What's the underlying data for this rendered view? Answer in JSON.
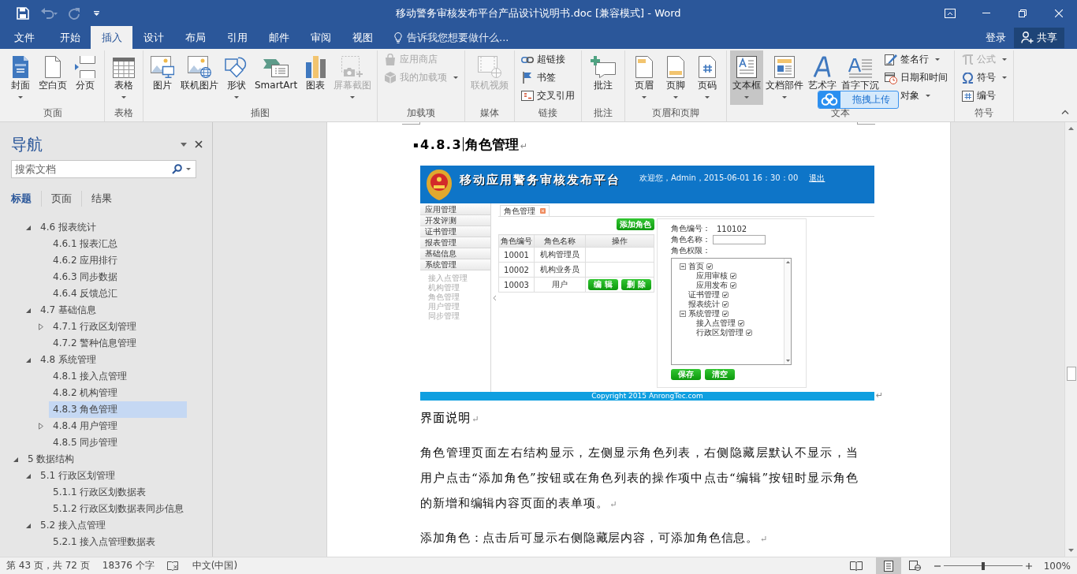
{
  "window": {
    "title": "移动警务审核发布平台产品设计说明书.doc [兼容模式] - Word"
  },
  "quick_access": [
    {
      "kind": "save",
      "disabled": false
    },
    {
      "kind": "undo",
      "disabled": true
    },
    {
      "kind": "redo",
      "disabled": true
    },
    {
      "kind": "customize",
      "disabled": false
    }
  ],
  "tabs": [
    {
      "label": "文件",
      "selected": false
    },
    {
      "label": "开始",
      "selected": false
    },
    {
      "label": "插入",
      "selected": true
    },
    {
      "label": "设计",
      "selected": false
    },
    {
      "label": "布局",
      "selected": false
    },
    {
      "label": "引用",
      "selected": false
    },
    {
      "label": "邮件",
      "selected": false
    },
    {
      "label": "审阅",
      "selected": false
    },
    {
      "label": "视图",
      "selected": false
    }
  ],
  "tell_me": {
    "placeholder": "告诉我您想要做什么..."
  },
  "account": {
    "sign_in": "登录",
    "share": "共享"
  },
  "ribbon": [
    {
      "label": "页面",
      "large": [
        {
          "label": "封面",
          "kind": "cover",
          "dropdown": true,
          "disabled": false,
          "pressed": false
        },
        {
          "label": "空白页",
          "kind": "blank",
          "dropdown": false,
          "disabled": false,
          "pressed": false
        },
        {
          "label": "分页",
          "kind": "break",
          "dropdown": false,
          "disabled": false,
          "pressed": false
        }
      ]
    },
    {
      "label": "表格",
      "large": [
        {
          "label": "表格",
          "kind": "table",
          "dropdown": true,
          "disabled": false,
          "pressed": false
        }
      ]
    },
    {
      "label": "插图",
      "large": [
        {
          "label": "图片",
          "kind": "picture",
          "dropdown": false,
          "disabled": false,
          "pressed": false
        },
        {
          "label": "联机图片",
          "kind": "online",
          "dropdown": false,
          "disabled": false,
          "pressed": false
        },
        {
          "label": "形状",
          "kind": "shapes",
          "dropdown": true,
          "disabled": false,
          "pressed": false
        },
        {
          "label": "SmartArt",
          "kind": "smartart",
          "dropdown": false,
          "disabled": false,
          "pressed": false
        },
        {
          "label": "图表",
          "kind": "chart",
          "dropdown": false,
          "disabled": false,
          "pressed": false
        },
        {
          "label": "屏幕截图",
          "kind": "screenshot",
          "dropdown": true,
          "disabled": true,
          "pressed": false
        }
      ]
    },
    {
      "label": "加载项",
      "small": [
        {
          "label": "应用商店",
          "kind": "store",
          "dropdown": false,
          "disabled": true
        },
        {
          "label": "我的加载项",
          "kind": "addins",
          "dropdown": true,
          "disabled": true
        }
      ]
    },
    {
      "label": "媒体",
      "large": [
        {
          "label": "联机视频",
          "kind": "video",
          "dropdown": false,
          "disabled": true,
          "pressed": false
        }
      ]
    },
    {
      "label": "链接",
      "small": [
        {
          "label": "超链接",
          "kind": "link",
          "dropdown": false,
          "disabled": false
        },
        {
          "label": "书签",
          "kind": "bookmark",
          "dropdown": false,
          "disabled": false
        },
        {
          "label": "交叉引用",
          "kind": "crossref",
          "dropdown": false,
          "disabled": false
        }
      ]
    },
    {
      "label": "批注",
      "large": [
        {
          "label": "批注",
          "kind": "comment",
          "dropdown": false,
          "disabled": false,
          "pressed": false
        }
      ]
    },
    {
      "label": "页眉和页脚",
      "large": [
        {
          "label": "页眉",
          "kind": "header",
          "dropdown": true,
          "disabled": false,
          "pressed": false
        },
        {
          "label": "页脚",
          "kind": "footer",
          "dropdown": true,
          "disabled": false,
          "pressed": false
        },
        {
          "label": "页码",
          "kind": "pagenum",
          "dropdown": true,
          "disabled": false,
          "pressed": false
        }
      ]
    },
    {
      "label": "文本",
      "large": [
        {
          "label": "文本框",
          "kind": "textbox",
          "dropdown": true,
          "disabled": false,
          "pressed": true
        },
        {
          "label": "文档部件",
          "kind": "parts",
          "dropdown": true,
          "disabled": false,
          "pressed": false
        },
        {
          "label": "艺术字",
          "kind": "wordart",
          "dropdown": false,
          "disabled": false,
          "pressed": false
        },
        {
          "label": "首字下沉",
          "kind": "dropcap",
          "dropdown": false,
          "disabled": false,
          "pressed": false
        }
      ],
      "small": [
        {
          "label": "签名行",
          "kind": "signature",
          "dropdown": true,
          "disabled": false
        },
        {
          "label": "日期和时间",
          "kind": "datetime",
          "dropdown": false,
          "disabled": false
        },
        {
          "label": "对象",
          "dropdown": true,
          "disabled": false
        }
      ]
    },
    {
      "label": "符号",
      "small": [
        {
          "label": "公式",
          "kind": "equation",
          "dropdown": true,
          "disabled": true
        },
        {
          "label": "符号",
          "kind": "symbol",
          "dropdown": true,
          "disabled": false
        },
        {
          "label": "编号",
          "kind": "number",
          "dropdown": false,
          "disabled": false
        }
      ]
    }
  ],
  "upload_widget": {
    "label": "拖拽上传"
  },
  "nav": {
    "title": "导航",
    "search": {
      "placeholder": "搜索文档"
    },
    "tabs": [
      {
        "label": "标题",
        "selected": true
      },
      {
        "label": "页面",
        "selected": false
      },
      {
        "label": "结果",
        "selected": false
      }
    ],
    "outline": [
      {
        "children": [
          {
            "label": "4.6 报表统计",
            "expanded": true,
            "selected": false,
            "children": [
              {
                "label": "4.6.1 报表汇总",
                "selected": false
              },
              {
                "label": "4.6.2 应用排行",
                "selected": false
              },
              {
                "label": "4.6.3 同步数据",
                "selected": false
              },
              {
                "label": "4.6.4 反馈总汇",
                "selected": false
              }
            ]
          },
          {
            "label": "4.7 基础信息",
            "expanded": true,
            "selected": false,
            "children": [
              {
                "label": "4.7.1 行政区划管理",
                "expanded": false,
                "selected": false
              },
              {
                "label": "4.7.2 警种信息管理",
                "selected": false
              }
            ]
          },
          {
            "label": "4.8 系统管理",
            "expanded": true,
            "selected": false,
            "children": [
              {
                "label": "4.8.1 接入点管理",
                "selected": false
              },
              {
                "label": "4.8.2 机构管理",
                "selected": false
              },
              {
                "label": "4.8.3 角色管理",
                "selected": true
              },
              {
                "label": "4.8.4 用户管理",
                "expanded": false,
                "selected": false
              },
              {
                "label": "4.8.5 同步管理",
                "selected": false
              }
            ]
          }
        ]
      },
      {
        "label": "5 数据结构",
        "expanded": true,
        "selected": false,
        "children": [
          {
            "label": "5.1 行政区划管理",
            "expanded": true,
            "selected": false,
            "children": [
              {
                "label": "5.1.1 行政区划数据表",
                "selected": false
              },
              {
                "label": "5.1.2 行政区划数据表同步信息",
                "selected": false
              }
            ]
          },
          {
            "label": "5.2 接入点管理",
            "expanded": true,
            "selected": false,
            "children": [
              {
                "label": "5.2.1 接入点管理数据表",
                "selected": false
              }
            ]
          }
        ]
      }
    ]
  },
  "document": {
    "heading": {
      "marker": "▪",
      "number": "4.8.3",
      "title": "角色管理",
      "mark": "↵",
      "cursor": true
    },
    "figure": {
      "mark": "↵",
      "app": {
        "title": "移动应用警务审核发布平台",
        "welcome": "欢迎您，Admin，2015-06-01 16：30：00",
        "logout": "退出",
        "menu": [
          {
            "label": "应用管理"
          },
          {
            "label": "开发评测"
          },
          {
            "label": "证书管理"
          },
          {
            "label": "报表管理"
          },
          {
            "label": "基础信息"
          },
          {
            "label": "系统管理",
            "children": [
              {
                "label": "接入点管理"
              },
              {
                "label": "机构管理"
              },
              {
                "label": "角色管理"
              },
              {
                "label": "用户管理"
              },
              {
                "label": "同步管理"
              }
            ]
          }
        ],
        "tabs": [
          {
            "label": "角色管理",
            "selected": true
          }
        ],
        "add_button": "添加角色",
        "table": {
          "columns": [
            "角色编号",
            "角色名称",
            "操作"
          ],
          "rows": [
            {
              "cells": [
                "10001",
                "机构管理员"
              ]
            },
            {
              "cells": [
                "10002",
                "机构业务员"
              ]
            },
            {
              "cells": [
                "10003",
                "用户"
              ],
              "actions": [
                "编 辑",
                "删 除"
              ]
            }
          ]
        },
        "form": {
          "id_label": "角色编号：",
          "id_value": "110102",
          "name_label": "角色名称：",
          "rights_label": "角色权限：",
          "rights": [
            {
              "label": "首页",
              "checked": true,
              "expanded": true,
              "children": [
                {
                  "label": "应用审核",
                  "checked": true
                },
                {
                  "label": "应用发布",
                  "checked": true
                }
              ]
            },
            {
              "label": "证书管理",
              "checked": true
            },
            {
              "label": "报表统计",
              "checked": true
            },
            {
              "label": "系统管理",
              "checked": true,
              "expanded": true,
              "children": [
                {
                  "label": "接入点管理",
                  "checked": true
                },
                {
                  "label": "行政区划管理",
                  "checked": true
                }
              ]
            }
          ],
          "buttons": [
            "保存",
            "清空"
          ]
        },
        "footer": "Copyright 2015 AnrongTec.com"
      }
    },
    "paragraphs": [
      {
        "text": "界面说明",
        "mark": "↵"
      },
      {
        "text": "角色管理页面左右结构显示，左侧显示角色列表，右侧隐藏层默认不显示，当用户点击“添加角色”按钮或在角色列表的操作项中点击“编辑”按钮时显示角色的新增和编辑内容页面的表单项。",
        "mark": "↵"
      },
      {
        "text": "添加角色：点击后可显示右侧隐藏层内容，可添加角色信息。",
        "mark": "↵"
      }
    ]
  },
  "status_bar": {
    "page": "第 43 页，共 72 页",
    "words": "18376 个字",
    "language": "中文(中国)",
    "views": [
      {
        "kind": "read",
        "selected": false
      },
      {
        "kind": "print",
        "selected": true
      },
      {
        "kind": "web",
        "selected": false
      }
    ],
    "zoom": {
      "level": 0.5,
      "reading": "100%"
    }
  }
}
